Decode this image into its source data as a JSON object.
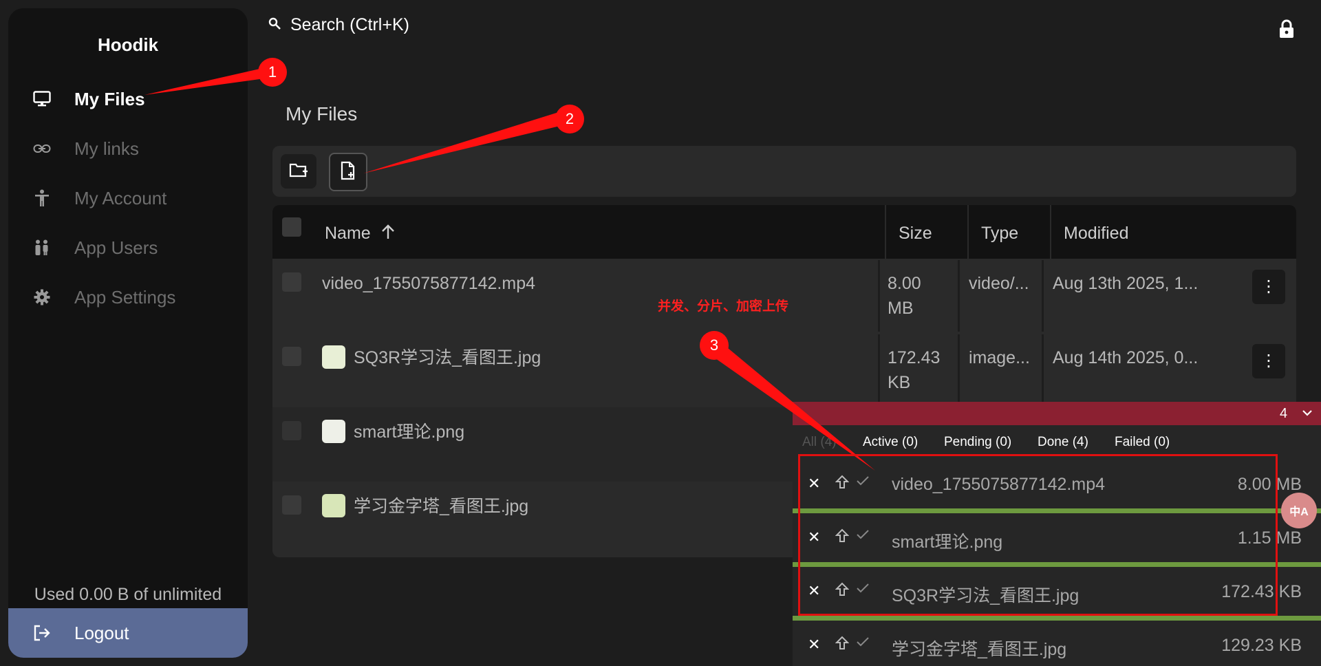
{
  "app": {
    "brand": "Hoodik"
  },
  "sidebar": {
    "items": [
      {
        "label": "My Files",
        "icon": "monitor-icon"
      },
      {
        "label": "My links",
        "icon": "link-icon"
      },
      {
        "label": "My Account",
        "icon": "person-icon"
      },
      {
        "label": "App Users",
        "icon": "users-icon"
      },
      {
        "label": "App Settings",
        "icon": "gear-icon"
      }
    ],
    "usage": "Used 0.00 B of unlimited",
    "logout": "Logout"
  },
  "header": {
    "search_label": "Search (Ctrl+K)"
  },
  "main": {
    "title": "My Files",
    "columns": {
      "name": "Name",
      "size": "Size",
      "type": "Type",
      "modified": "Modified"
    },
    "rows": [
      {
        "name": "video_1755075877142.mp4",
        "size_line1": "8.00",
        "size_line2": "MB",
        "type": "video/...",
        "modified": "Aug 13th 2025, 1..."
      },
      {
        "name": "SQ3R学习法_看图王.jpg",
        "size_line1": "172.43",
        "size_line2": "KB",
        "type": "image...",
        "modified": "Aug 14th 2025, 0..."
      },
      {
        "name": "smart理论.png",
        "size_line1": "",
        "size_line2": "",
        "type": "",
        "modified": ""
      },
      {
        "name": "学习金字塔_看图王.jpg",
        "size_line1": "",
        "size_line2": "",
        "type": "",
        "modified": ""
      }
    ]
  },
  "upload_panel": {
    "count": "4",
    "tabs": [
      "All (4)",
      "Active (0)",
      "Pending (0)",
      "Done (4)",
      "Failed (0)"
    ],
    "items": [
      {
        "name": "video_1755075877142.mp4",
        "size": "8.00 MB"
      },
      {
        "name": "smart理论.png",
        "size": "1.15 MB"
      },
      {
        "name": "SQ3R学习法_看图王.jpg",
        "size": "172.43 KB"
      },
      {
        "name": "学习金字塔_看图王.jpg",
        "size": "129.23 KB"
      }
    ]
  },
  "annotations": {
    "badge1": "1",
    "badge2": "2",
    "badge3": "3",
    "note": "并发、分片、加密上传",
    "float_icon": "中A"
  },
  "colors": {
    "accent": "#5b6b96",
    "upload_header": "#8b2031",
    "progress": "#6d9a3f",
    "annotation": "#ff1010"
  }
}
